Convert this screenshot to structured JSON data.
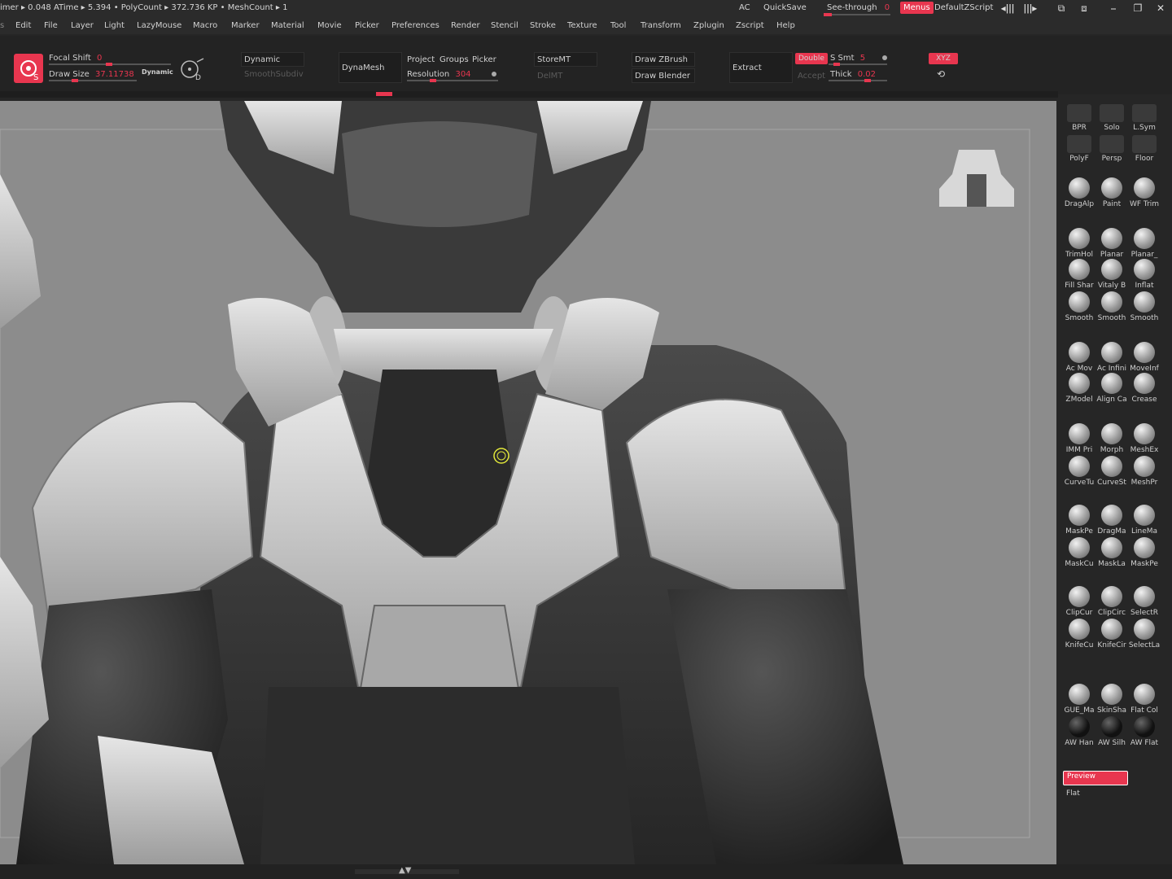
{
  "status": {
    "metrics": "imer ▸ 0.048 ATime ▸ 5.394  •  PolyCount ▸ 372.736 KP  •  MeshCount ▸ 1",
    "ac": "AC",
    "quicksave": "QuickSave",
    "see_through_label": "See-through",
    "see_through_value": "0",
    "menus": "Menus",
    "script": "DefaultZScript"
  },
  "menu": [
    "Edit",
    "File",
    "Layer",
    "Light",
    "LazyMouse",
    "Macro",
    "Marker",
    "Material",
    "Movie",
    "Picker",
    "Preferences",
    "Render",
    "Stencil",
    "Stroke",
    "Texture",
    "Tool",
    "Transform",
    "Zplugin",
    "Zscript",
    "Help"
  ],
  "toolbar": {
    "focal_label": "Focal Shift",
    "focal_value": "0",
    "drawsize_label": "Draw Size",
    "drawsize_value": "37.11738",
    "dynamic_small": "Dynamic",
    "dynamic": "Dynamic",
    "smooth_subdiv": "SmoothSubdiv",
    "dynamesh": "DynaMesh",
    "project": "Project",
    "groups": "Groups",
    "picker": "Picker",
    "resolution_label": "Resolution",
    "resolution_value": "304",
    "storemt": "StoreMT",
    "delmt": "DelMT",
    "draw_zbrush": "Draw ZBrush",
    "draw_blender": "Draw Blender",
    "extract": "Extract",
    "accept": "Accept",
    "double": "Double",
    "ssmt_label": "S Smt",
    "ssmt_value": "5",
    "thick_label": "Thick",
    "thick_value": "0.02",
    "xyz": "XYZ"
  },
  "shelf": {
    "top": [
      {
        "label": "BPR"
      },
      {
        "label": "Solo"
      },
      {
        "label": "L.Sym"
      },
      {
        "label": "PolyF"
      },
      {
        "label": "Persp"
      },
      {
        "label": "Floor"
      }
    ],
    "brushes": [
      [
        "DragAlp",
        "Paint",
        "WF Trim"
      ],
      [
        "TrimHol",
        "Planar",
        "Planar_"
      ],
      [
        "Fill Shar",
        "Vitaly B",
        "Inflat"
      ],
      [
        "Smooth",
        "Smooth",
        "Smooth"
      ],
      [
        "Ac Mov",
        "Ac Infini",
        "MoveInf"
      ],
      [
        "ZModel",
        "Align Ca",
        "Crease"
      ],
      [
        "IMM Pri",
        "Morph",
        "MeshEx"
      ],
      [
        "CurveTu",
        "CurveSt",
        "MeshPr"
      ],
      [
        "MaskPe",
        "DragMa",
        "LineMa"
      ],
      [
        "MaskCu",
        "MaskLa",
        "MaskPe"
      ],
      [
        "ClipCur",
        "ClipCirc",
        "SelectR"
      ],
      [
        "KnifeCu",
        "KnifeCir",
        "SelectLa"
      ],
      [
        "GUE_Ma",
        "SkinSha",
        "Flat Col"
      ],
      [
        "AW Han",
        "AW Silh",
        "AW Flat"
      ]
    ],
    "preview": "Preview",
    "flat": "Flat"
  }
}
